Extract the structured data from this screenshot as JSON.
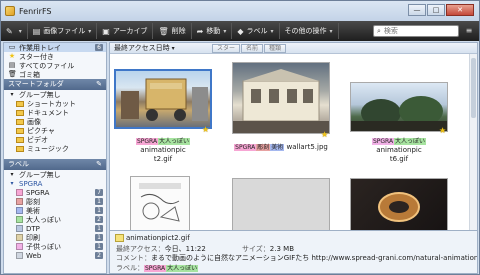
{
  "window": {
    "title": "FenrirFS",
    "minimize": "—",
    "maximize": "□",
    "close": "✕"
  },
  "toolbar": {
    "new_label": "",
    "file_label": "画像ファイル",
    "archive_label": "アーカイブ",
    "delete_label": "削除",
    "move_label": "移動",
    "label_label": "ラベル",
    "other_label": "その他の操作",
    "search_placeholder": "検索",
    "menu_glyph": "≡"
  },
  "sidebar": {
    "sections": {
      "top": [
        {
          "label": "作業用トレイ",
          "count": "6",
          "selected": true
        },
        {
          "label": "スター付き"
        },
        {
          "label": "すべてのファイル"
        },
        {
          "label": "ゴミ箱"
        }
      ],
      "smart_header": "スマートフォルダ",
      "group_none": "グループ無し",
      "smart_items": [
        "ショートカット",
        "ドキュメント",
        "画像",
        "ピクチャ",
        "ビデオ",
        "ミュージック"
      ],
      "label_header": "ラベル",
      "label_group_none": "グループ無し",
      "label_group": "SPGRA",
      "label_items": [
        {
          "label": "SPGRA",
          "count": "7",
          "color": "#f7a6d4"
        },
        {
          "label": "彫刻",
          "count": "1",
          "color": "#e7a2a2"
        },
        {
          "label": "美術",
          "count": "1",
          "color": "#a5b8ef"
        },
        {
          "label": "大人っぽい",
          "count": "2",
          "color": "#a7e3a0"
        },
        {
          "label": "DTP",
          "count": "1",
          "color": "#b9c7e0"
        },
        {
          "label": "印刷",
          "count": "1",
          "color": "#dfd2a8"
        },
        {
          "label": "子供っぽい",
          "count": "1",
          "color": "#f1b1e6"
        },
        {
          "label": "Web",
          "count": "2",
          "color": "#cfd6e0"
        }
      ]
    }
  },
  "main": {
    "sort_label": "最終アクセス日時",
    "sort_buttons": [
      "スター",
      "名前",
      "種類"
    ],
    "items": [
      {
        "name": "animationpict2.gif",
        "tags": [
          "SPGRA",
          "大人っぽい"
        ],
        "caption_pre": "animationpic",
        "caption_post": "t2.gif"
      },
      {
        "name": "wallart5.jpg",
        "tags": [
          "SPGRA",
          "彫刻",
          "美術"
        ],
        "caption_pre": "wallart5.jpg",
        "caption_post": ""
      },
      {
        "name": "animationpict6.gif",
        "tags": [
          "SPGRA",
          "大人っぽい"
        ],
        "caption_pre": "animationpic",
        "caption_post": "t6.gif"
      }
    ],
    "info": {
      "filename": "animationpict2.gif",
      "access_label": "最終アクセス：",
      "access_value": "今日、11:22",
      "size_label": "サイズ：",
      "size_value": "2.3 MB",
      "comment_label": "コメント：",
      "comment_value": "まるで動画のように自然なアニメーションGIFたち",
      "url_value": "http://www.spread-grani.com/natural-animation-gif.html",
      "label_label": "ラベル：",
      "tags": [
        "SPGRA",
        "大人っぽい"
      ]
    }
  },
  "colors": {
    "spgra": "#f7a6d4",
    "otona": "#a7e3a0",
    "chokoku": "#e7a2a2",
    "bijutsu": "#a5b8ef",
    "selection": "#3f77c8"
  }
}
